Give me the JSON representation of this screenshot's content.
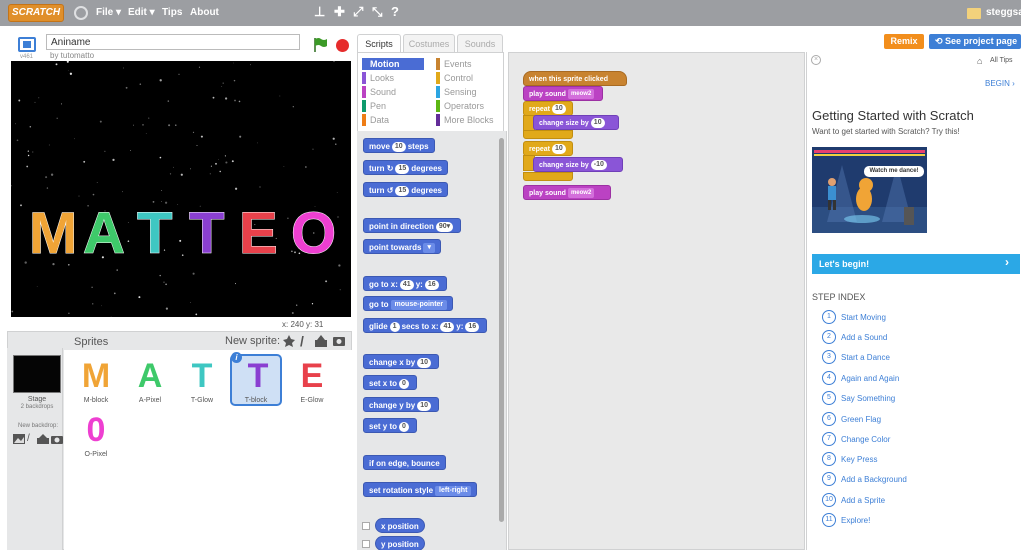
{
  "menubar": {
    "logo": "SCRATCH",
    "menus": [
      "File ▾",
      "Edit ▾",
      "Tips",
      "About"
    ],
    "username": "steggsa"
  },
  "project": {
    "title": "Aniname",
    "author": "by tutomatto",
    "stage_mode_version": "v461"
  },
  "stage": {
    "word_letters": [
      "M",
      "A",
      "T",
      "T",
      "E",
      "O"
    ],
    "letter_colors": [
      "#f0a436",
      "#3ec96a",
      "#3ec7c2",
      "#8a3fd1",
      "#e8414b",
      "#ee3fd1"
    ],
    "coords_x": "x: 240",
    "coords_y": "y: 31"
  },
  "sprites": {
    "header": "Sprites",
    "new_sprite": "New sprite:",
    "stage_label": "Stage",
    "stage_backdrops": "2 backdrops",
    "new_backdrop": "New backdrop:",
    "items": [
      {
        "name": "M-block",
        "glyph": "M",
        "color": "#f0a436"
      },
      {
        "name": "A-Pixel",
        "glyph": "A",
        "color": "#3ec96a"
      },
      {
        "name": "T-Glow",
        "glyph": "T",
        "color": "#3ec7c2"
      },
      {
        "name": "T-block",
        "glyph": "T",
        "color": "#8a3fd1"
      },
      {
        "name": "E-Glow",
        "glyph": "E",
        "color": "#e8414b"
      },
      {
        "name": "O-Pixel",
        "glyph": "0",
        "color": "#ee3fd1"
      }
    ]
  },
  "tabs": [
    "Scripts",
    "Costumes",
    "Sounds"
  ],
  "categories": [
    {
      "label": "Motion",
      "color": "#4a6cd4",
      "active": true
    },
    {
      "label": "Looks",
      "color": "#8a55d7"
    },
    {
      "label": "Sound",
      "color": "#bb42c3"
    },
    {
      "label": "Pen",
      "color": "#0e9a6c"
    },
    {
      "label": "Data",
      "color": "#ee7d16"
    },
    {
      "label": "Events",
      "color": "#c88330"
    },
    {
      "label": "Control",
      "color": "#e1a91a"
    },
    {
      "label": "Sensing",
      "color": "#2ca5e2"
    },
    {
      "label": "Operators",
      "color": "#5cb712"
    },
    {
      "label": "More Blocks",
      "color": "#632d99"
    }
  ],
  "palette": {
    "move": "move",
    "move_n": "10",
    "move_suffix": "steps",
    "turn_r": "turn ↻",
    "turn_r_n": "15",
    "turn_l": "turn ↺",
    "turn_l_n": "15",
    "degrees": "degrees",
    "point_dir": "point in direction",
    "point_dir_val": "90▾",
    "point_towards": "point towards",
    "goto_xy": "go to x:",
    "goto_x": "41",
    "goto_y_label": "y:",
    "goto_y": "16",
    "goto": "go to",
    "goto_val": "mouse-pointer",
    "glide": "glide",
    "glide_n": "1",
    "glide_mid": "secs to x:",
    "glide_x": "41",
    "glide_y_label": "y:",
    "glide_y": "16",
    "change_x": "change x by",
    "change_x_n": "10",
    "set_x": "set x to",
    "set_x_n": "0",
    "change_y": "change y by",
    "change_y_n": "10",
    "set_y": "set y to",
    "set_y_n": "0",
    "bounce": "if on edge, bounce",
    "rotation": "set rotation style",
    "rotation_val": "left-right",
    "x_pos": "x position",
    "y_pos": "y position"
  },
  "script": {
    "hat": "when this sprite clicked",
    "sound1": "play sound",
    "sound1_val": "meow2",
    "repeat1": "repeat",
    "repeat1_n": "10",
    "change1": "change size by",
    "change1_n": "10",
    "repeat2": "repeat",
    "repeat2_n": "10",
    "change2": "change size by",
    "change2_n": "-10",
    "sound2": "play sound",
    "sound2_val": "meow2"
  },
  "tips": {
    "remix": "Remix",
    "see_page": "See project page",
    "all_tips": "All Tips",
    "begin": "BEGIN",
    "title": "Getting Started with Scratch",
    "subtitle": "Want to get started with Scratch? Try this!",
    "watch": "Watch me dance!",
    "lets_begin": "Let's begin!",
    "step_index": "STEP INDEX",
    "steps": [
      "Start Moving",
      "Add a Sound",
      "Start a Dance",
      "Again and Again",
      "Say Something",
      "Green Flag",
      "Change Color",
      "Key Press",
      "Add a Background",
      "Add a Sprite",
      "Explore!"
    ]
  }
}
